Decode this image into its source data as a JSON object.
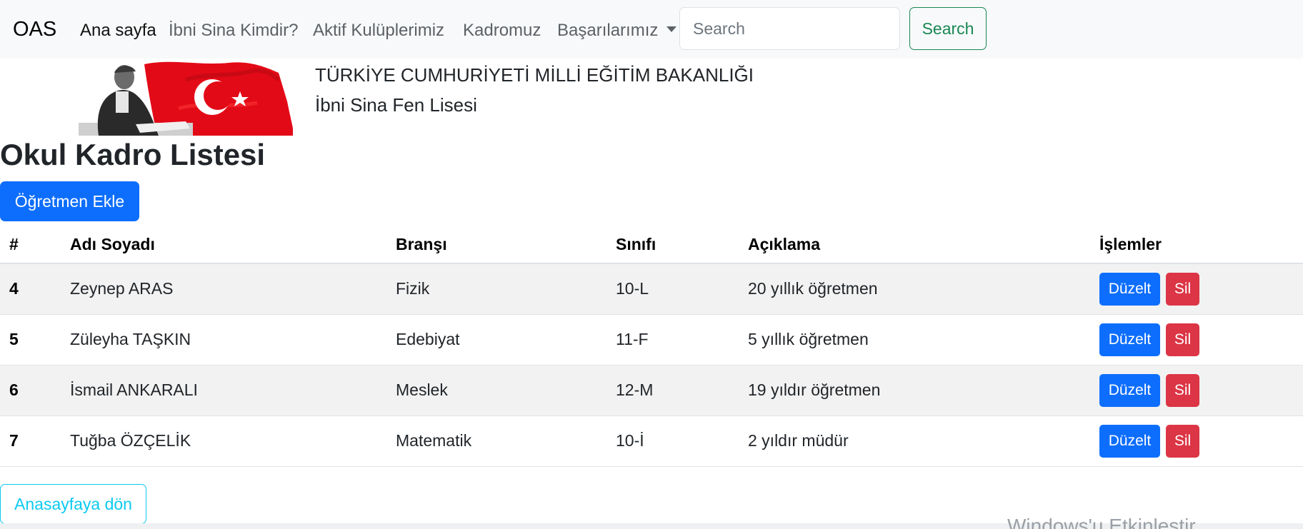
{
  "navbar": {
    "brand": "OAS",
    "links": [
      {
        "label": "Ana sayfa"
      },
      {
        "label": "İbni Sina Kimdir?"
      },
      {
        "label": "Aktif Kulüplerimiz"
      },
      {
        "label": "Kadromuz"
      },
      {
        "label": "Başarılarımız"
      }
    ],
    "search_placeholder": "Search",
    "search_button": "Search"
  },
  "header": {
    "ministry": "TÜRKİYE CUMHURİYETİ MİLLİ EĞİTİM BAKANLIĞI",
    "school": "İbni Sina Fen Lisesi"
  },
  "main": {
    "title": "Okul Kadro Listesi",
    "add_button": "Öğretmen Ekle",
    "table": {
      "headers": [
        "#",
        "Adı Soyadı",
        "Branşı",
        "Sınıfı",
        "Açıklama",
        "İşlemler"
      ],
      "rows": [
        {
          "id": "4",
          "name": "Zeynep ARAS",
          "branch": "Fizik",
          "class": "10-L",
          "note": "20 yıllık öğretmen"
        },
        {
          "id": "5",
          "name": "Züleyha TAŞKIN",
          "branch": "Edebiyat",
          "class": "11-F",
          "note": "5 yıllık öğretmen"
        },
        {
          "id": "6",
          "name": "İsmail ANKARALI",
          "branch": "Meslek",
          "class": "12-M",
          "note": "19 yıldır öğretmen"
        },
        {
          "id": "7",
          "name": "Tuğba ÖZÇELİK",
          "branch": "Matematik",
          "class": "10-İ",
          "note": "2 yıldır müdür"
        }
      ],
      "edit_label": "Düzelt",
      "delete_label": "Sil"
    },
    "back_button": "Anasayfaya dön"
  },
  "watermark": "Windows'u Etkinleştir",
  "colors": {
    "primary": "#0d6efd",
    "danger": "#dc3545",
    "success": "#198754",
    "info": "#0dcaf0",
    "navbar_bg": "#f8f9fa",
    "flag_red": "#e30a17"
  },
  "icons": {
    "dropdown": "caret-down-icon",
    "header_image": "ataturk-flag-image"
  }
}
